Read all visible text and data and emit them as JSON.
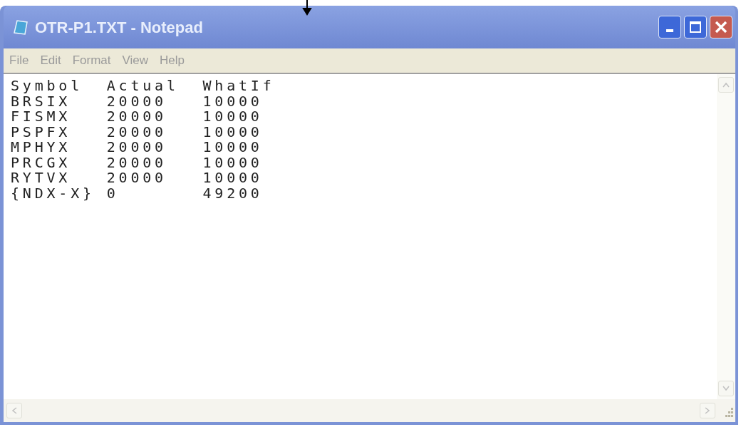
{
  "window": {
    "title": "OTR-P1.TXT - Notepad"
  },
  "menu": [
    "File",
    "Edit",
    "Format",
    "View",
    "Help"
  ],
  "document": {
    "lines": [
      "Symbol  Actual  WhatIf",
      "BRSIX   20000   10000",
      "FISMX   20000   10000",
      "PSPFX   20000   10000",
      "MPHYX   20000   10000",
      "PRCGX   20000   10000",
      "RYTVX   20000   10000",
      "{NDX-X} 0       49200"
    ]
  }
}
